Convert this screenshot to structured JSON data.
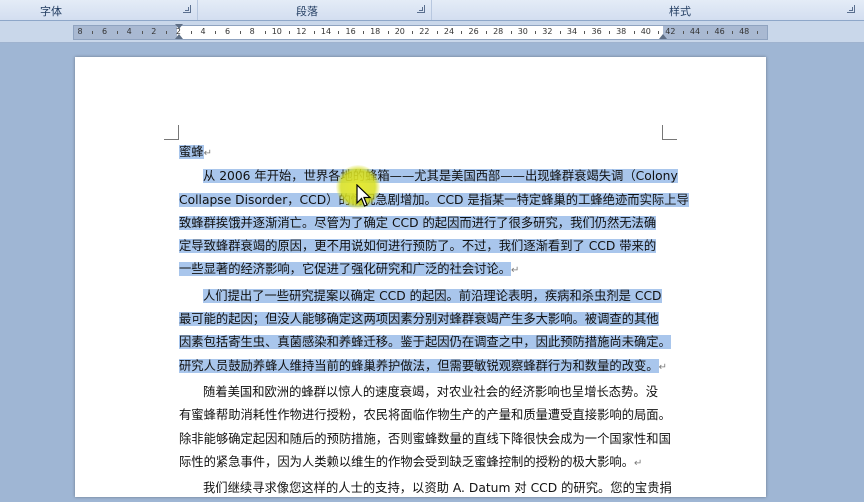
{
  "ribbon": {
    "groups": [
      {
        "label": "字体",
        "has_launcher": true
      },
      {
        "label": "段落",
        "has_launcher": true
      },
      {
        "label": "样式",
        "has_launcher": true
      }
    ]
  },
  "ruler": {
    "ticks": [
      "8",
      "6",
      "4",
      "2",
      "2",
      "4",
      "6",
      "8",
      "10",
      "12",
      "14",
      "16",
      "18",
      "20",
      "22",
      "24",
      "26",
      "28",
      "30",
      "32",
      "34",
      "36",
      "38",
      "40",
      "42",
      "44",
      "46",
      "48"
    ]
  },
  "document": {
    "title": "蜜蜂",
    "paragraphs": [
      {
        "selected": true,
        "lines": [
          "从 2006 年开始，世界各地的蜂箱——尤其是美国西部——出现蜂群衰竭失调（Colony",
          "Collapse Disorder，CCD）的情况急剧增加。CCD 是指某一特定蜂巢的工蜂绝迹而实际上导",
          "致蜂群挨饿并逐渐消亡。尽管为了确定 CCD 的起因而进行了很多研究，我们仍然无法确",
          "定导致蜂群衰竭的原因，更不用说如何进行预防了。不过，我们逐渐看到了 CCD 带来的",
          "一些显著的经济影响，它促进了强化研究和广泛的社会讨论。"
        ]
      },
      {
        "selected": true,
        "lines": [
          "人们提出了一些研究提案以确定 CCD 的起因。前沿理论表明，疾病和杀虫剂是 CCD",
          "最可能的起因；但没人能够确定这两项因素分别对蜂群衰竭产生多大影响。被调查的其他",
          "因素包括寄生虫、真菌感染和养蜂迁移。鉴于起因仍在调查之中，因此预防措施尚未确定。",
          "研究人员鼓励养蜂人维持当前的蜂巢养护做法，但需要敏锐观察蜂群行为和数量的改变。"
        ]
      },
      {
        "selected": false,
        "lines": [
          "随着美国和欧洲的蜂群以惊人的速度衰竭，对农业社会的经济影响也呈增长态势。没",
          "有蜜蜂帮助消耗性作物进行授粉，农民将面临作物生产的产量和质量遭受直接影响的局面。",
          "除非能够确定起因和随后的预防措施，否则蜜蜂数量的直线下降很快会成为一个国家性和国",
          "际性的紧急事件，因为人类赖以维生的作物会受到缺乏蜜蜂控制的授粉的极大影响。"
        ]
      },
      {
        "selected": false,
        "lines": [
          "我们继续寻求像您这样的人士的支持，以资助 A. Datum 对 CCD 的研究。您的宝贵捐"
        ]
      }
    ]
  },
  "colors": {
    "selection": "#a9c6ec",
    "cursor_halo": "#e4e828"
  },
  "icons": {
    "cursor": "mouse-pointer-icon",
    "dialog_launcher": "dialog-launcher-icon"
  }
}
